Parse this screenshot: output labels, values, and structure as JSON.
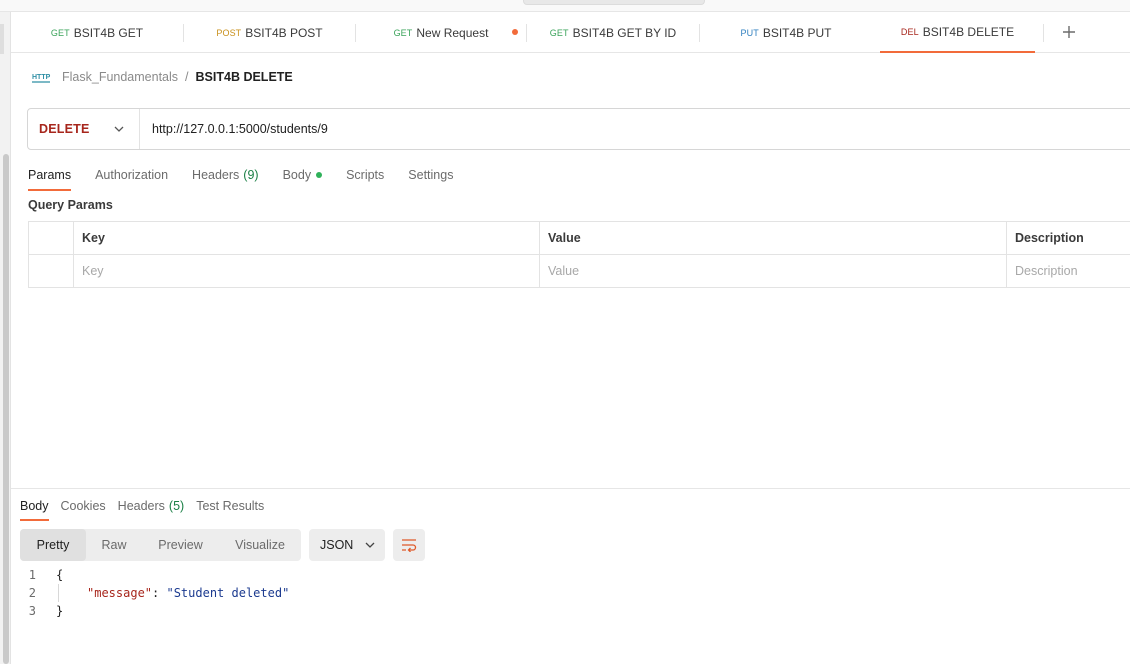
{
  "tabs": [
    {
      "method": "GET",
      "method_color": "#3aa35a",
      "name": "BSIT4B GET"
    },
    {
      "method": "POST",
      "method_color": "#c9901b",
      "name": "BSIT4B POST"
    },
    {
      "method": "GET",
      "method_color": "#3aa35a",
      "name": "New Request",
      "unsaved": true
    },
    {
      "method": "GET",
      "method_color": "#3aa35a",
      "name": "BSIT4B GET BY ID"
    },
    {
      "method": "PUT",
      "method_color": "#2f7fbf",
      "name": "BSIT4B PUT"
    },
    {
      "method": "DEL",
      "method_color": "#a7261c",
      "name": "BSIT4B DELETE",
      "active": true
    }
  ],
  "breadcrumb": {
    "icon": "http-icon",
    "collection": "Flask_Fundamentals",
    "separator": "/",
    "request": "BSIT4B DELETE"
  },
  "request": {
    "method": "DELETE",
    "url": "http://127.0.0.1:5000/students/9",
    "tabs": {
      "params": "Params",
      "authorization": "Authorization",
      "headers": "Headers",
      "headers_count": "(9)",
      "body": "Body",
      "scripts": "Scripts",
      "settings": "Settings"
    },
    "query_params_title": "Query Params",
    "table": {
      "columns": [
        "Key",
        "Value",
        "Description"
      ],
      "placeholders": [
        "Key",
        "Value",
        "Description"
      ]
    }
  },
  "response": {
    "tabs": {
      "body": "Body",
      "cookies": "Cookies",
      "headers": "Headers",
      "headers_count": "(5)",
      "test_results": "Test Results"
    },
    "views": [
      "Pretty",
      "Raw",
      "Preview",
      "Visualize"
    ],
    "format": "JSON",
    "lines": [
      {
        "n": "1",
        "text": "{"
      },
      {
        "n": "2",
        "key": "\"message\"",
        "colon": ": ",
        "value": "\"Student deleted\""
      },
      {
        "n": "3",
        "text": "}"
      }
    ]
  },
  "colors": {
    "accent": "#f26b3a",
    "delete_method": "#a7261c",
    "count_green": "#1a7f45"
  }
}
